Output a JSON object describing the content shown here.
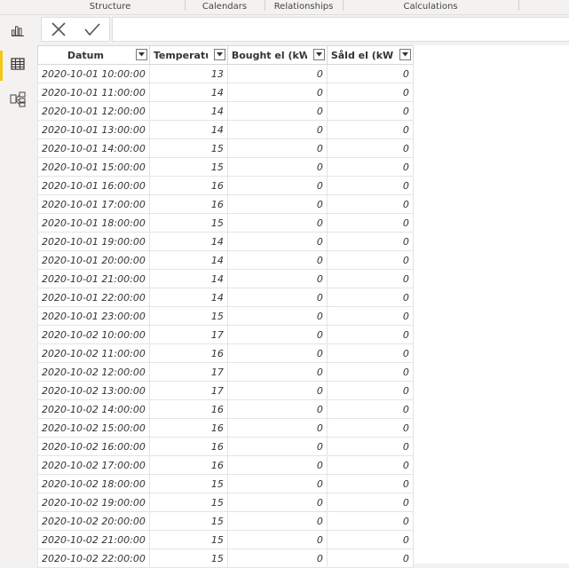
{
  "ribbon": {
    "groups": [
      "Structure",
      "Calendars",
      "Relationships",
      "Calculations"
    ]
  },
  "nav": {
    "items": [
      {
        "name": "report-view",
        "icon": "bar-chart-icon"
      },
      {
        "name": "data-view",
        "icon": "table-icon",
        "active": true
      },
      {
        "name": "model-view",
        "icon": "model-icon"
      }
    ]
  },
  "formula_bar": {
    "cancel_icon": "close-icon",
    "commit_icon": "checkmark-icon",
    "value": ""
  },
  "table": {
    "columns": [
      "Datum",
      "Temperatur",
      "Bought el (kWh)",
      "Såld el (kWh)"
    ],
    "rows": [
      [
        "2020-10-01 10:00:00",
        "13",
        "0",
        "0"
      ],
      [
        "2020-10-01 11:00:00",
        "14",
        "0",
        "0"
      ],
      [
        "2020-10-01 12:00:00",
        "14",
        "0",
        "0"
      ],
      [
        "2020-10-01 13:00:00",
        "14",
        "0",
        "0"
      ],
      [
        "2020-10-01 14:00:00",
        "15",
        "0",
        "0"
      ],
      [
        "2020-10-01 15:00:00",
        "15",
        "0",
        "0"
      ],
      [
        "2020-10-01 16:00:00",
        "16",
        "0",
        "0"
      ],
      [
        "2020-10-01 17:00:00",
        "16",
        "0",
        "0"
      ],
      [
        "2020-10-01 18:00:00",
        "15",
        "0",
        "0"
      ],
      [
        "2020-10-01 19:00:00",
        "14",
        "0",
        "0"
      ],
      [
        "2020-10-01 20:00:00",
        "14",
        "0",
        "0"
      ],
      [
        "2020-10-01 21:00:00",
        "14",
        "0",
        "0"
      ],
      [
        "2020-10-01 22:00:00",
        "14",
        "0",
        "0"
      ],
      [
        "2020-10-01 23:00:00",
        "15",
        "0",
        "0"
      ],
      [
        "2020-10-02 10:00:00",
        "17",
        "0",
        "0"
      ],
      [
        "2020-10-02 11:00:00",
        "16",
        "0",
        "0"
      ],
      [
        "2020-10-02 12:00:00",
        "17",
        "0",
        "0"
      ],
      [
        "2020-10-02 13:00:00",
        "17",
        "0",
        "0"
      ],
      [
        "2020-10-02 14:00:00",
        "16",
        "0",
        "0"
      ],
      [
        "2020-10-02 15:00:00",
        "16",
        "0",
        "0"
      ],
      [
        "2020-10-02 16:00:00",
        "16",
        "0",
        "0"
      ],
      [
        "2020-10-02 17:00:00",
        "16",
        "0",
        "0"
      ],
      [
        "2020-10-02 18:00:00",
        "15",
        "0",
        "0"
      ],
      [
        "2020-10-02 19:00:00",
        "15",
        "0",
        "0"
      ],
      [
        "2020-10-02 20:00:00",
        "15",
        "0",
        "0"
      ],
      [
        "2020-10-02 21:00:00",
        "15",
        "0",
        "0"
      ],
      [
        "2020-10-02 22:00:00",
        "15",
        "0",
        "0"
      ]
    ]
  },
  "colors": {
    "accent": "#f2c811",
    "border": "#d8d8d8"
  }
}
